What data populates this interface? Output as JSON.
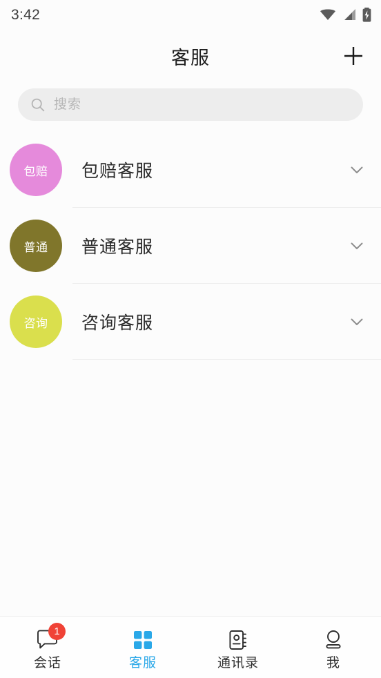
{
  "status_bar": {
    "time": "3:42",
    "icons": [
      "wifi-icon",
      "cellular-signal-icon",
      "battery-charging-icon"
    ]
  },
  "header": {
    "title": "客服",
    "add_button_label": "+",
    "add_icon": "plus-icon"
  },
  "search": {
    "placeholder": "搜索",
    "value": "",
    "icon": "search-icon"
  },
  "list": {
    "items": [
      {
        "avatar_text": "包赔",
        "avatar_color": "#e58adb",
        "label": "包赔客服",
        "chevron": "chevron-down-icon",
        "expanded": false
      },
      {
        "avatar_text": "普通",
        "avatar_color": "#80762b",
        "label": "普通客服",
        "chevron": "chevron-down-icon",
        "expanded": false
      },
      {
        "avatar_text": "咨询",
        "avatar_color": "#dadf4d",
        "label": "咨询客服",
        "chevron": "chevron-down-icon",
        "expanded": false
      }
    ]
  },
  "tabbar": {
    "active_index": 1,
    "active_color": "#2aa8e8",
    "badge_color": "#f04236",
    "items": [
      {
        "label": "会话",
        "icon": "chat-bubble-icon",
        "badge": "1"
      },
      {
        "label": "客服",
        "icon": "grid-squares-icon",
        "badge": ""
      },
      {
        "label": "通讯录",
        "icon": "contact-book-icon",
        "badge": ""
      },
      {
        "label": "我",
        "icon": "person-icon",
        "badge": ""
      }
    ]
  }
}
